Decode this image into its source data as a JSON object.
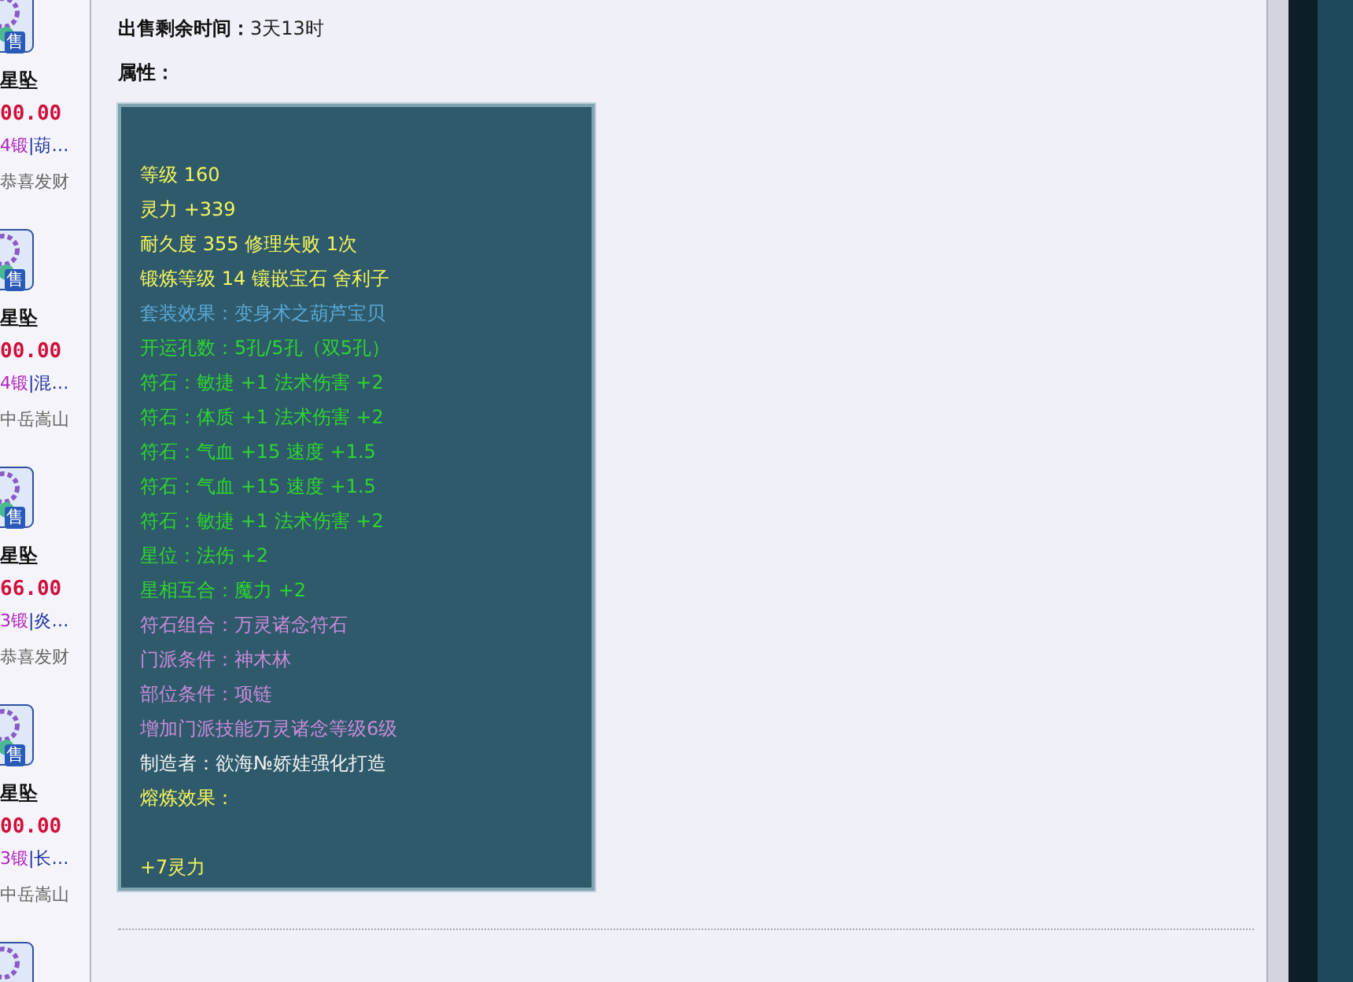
{
  "sidebar": {
    "items": [
      {
        "badge": "售",
        "name": "星坠",
        "price": "00.00",
        "forge": "4锻",
        "detail": "|葫…",
        "seller": "恭喜发财"
      },
      {
        "badge": "售",
        "name": "星坠",
        "price": "00.00",
        "forge": "4锻",
        "detail": "|混…",
        "seller": "中岳嵩山"
      },
      {
        "badge": "售",
        "name": "星坠",
        "price": "66.00",
        "forge": "3锻",
        "detail": "|炎…",
        "seller": "恭喜发财"
      },
      {
        "badge": "售",
        "name": "星坠",
        "price": "00.00",
        "forge": "3锻",
        "detail": "|长…",
        "seller": "中岳嵩山"
      }
    ]
  },
  "sale_time": {
    "label": "出售剩余时间：",
    "value": "3天13时"
  },
  "attributes_label": "属性：",
  "attributes": [
    {
      "text": "等级 160",
      "kind": "yellow"
    },
    {
      "text": "灵力 +339",
      "kind": "yellow"
    },
    {
      "text": "耐久度 355 修理失败 1次",
      "kind": "yellow"
    },
    {
      "text": "锻炼等级 14 镶嵌宝石 舍利子",
      "kind": "yellow"
    },
    {
      "text": "套装效果：变身术之葫芦宝贝",
      "kind": "blue"
    },
    {
      "text": "开运孔数：5孔/5孔（双5孔）",
      "kind": "green"
    },
    {
      "text": "符石：敏捷 +1 法术伤害 +2",
      "kind": "green"
    },
    {
      "text": "符石：体质 +1 法术伤害 +2",
      "kind": "green"
    },
    {
      "text": "符石：气血 +15 速度 +1.5",
      "kind": "green"
    },
    {
      "text": "符石：气血 +15 速度 +1.5",
      "kind": "green"
    },
    {
      "text": "符石：敏捷 +1 法术伤害 +2",
      "kind": "green"
    },
    {
      "text": "星位：法伤 +2",
      "kind": "green"
    },
    {
      "text": "星相互合：魔力 +2",
      "kind": "green"
    },
    {
      "text": "符石组合：万灵诸念符石",
      "kind": "purple"
    },
    {
      "text": "门派条件：神木林",
      "kind": "purple"
    },
    {
      "text": "部位条件：项链",
      "kind": "purple"
    },
    {
      "text": "增加门派技能万灵诸念等级6级",
      "kind": "purple"
    },
    {
      "text": "制造者：欲海№娇娃强化打造",
      "kind": "white"
    },
    {
      "text": "熔炼效果：",
      "kind": "yellow"
    },
    {
      "text": "+7灵力",
      "kind": "yellow",
      "blank_before": true
    }
  ]
}
